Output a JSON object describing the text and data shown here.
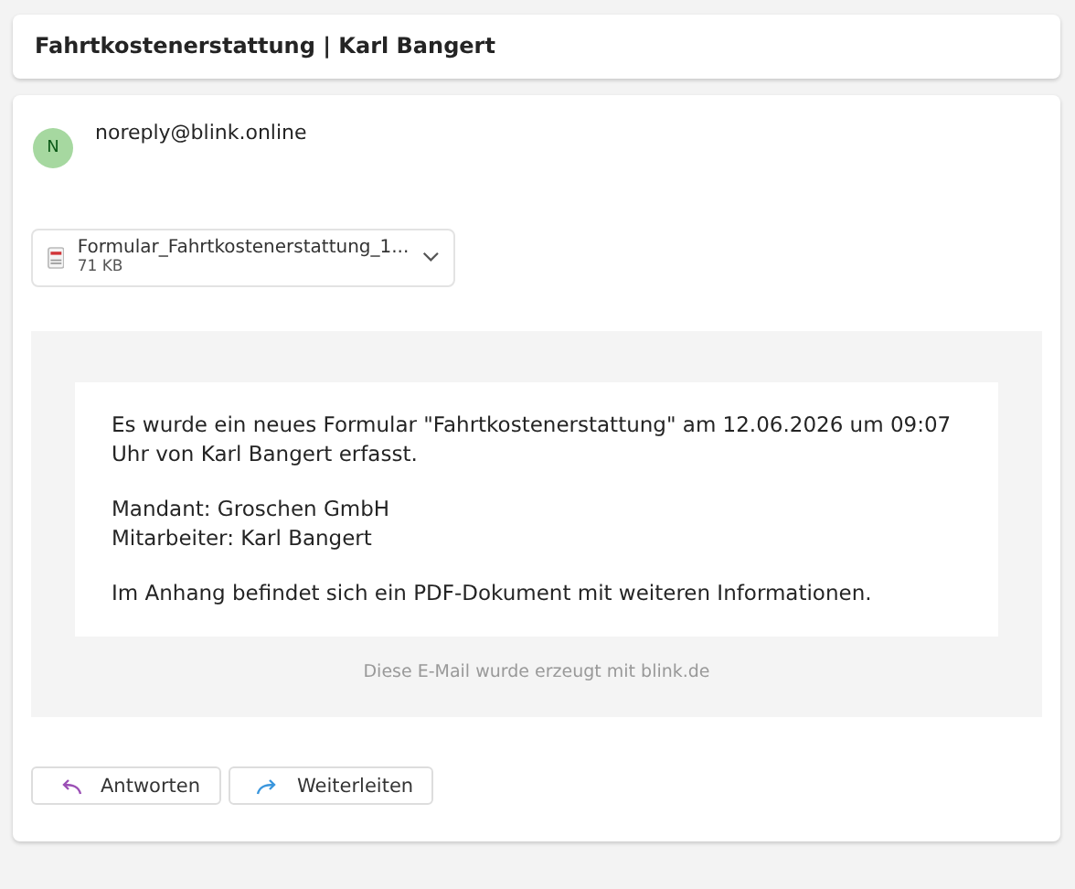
{
  "subject": "Fahrtkostenerstattung | Karl Bangert",
  "sender": {
    "initial": "N",
    "address": "noreply@blink.online"
  },
  "attachment": {
    "name": "Formular_Fahrtkostenerstattung_1...",
    "size": "71 KB"
  },
  "body": {
    "paragraphs": [
      [
        "Es wurde ein neues Formular \"Fahrtkostenerstattung\" am 12.06.2026 um 09:07 Uhr von Karl Bangert erfasst."
      ],
      [
        "Mandant: Groschen GmbH",
        "Mitarbeiter: Karl Bangert"
      ],
      [
        "Im Anhang befindet sich ein PDF-Dokument mit weiteren Informationen."
      ]
    ],
    "footer": "Diese E-Mail wurde erzeugt mit blink.de"
  },
  "actions": [
    {
      "kind": "reply",
      "label": "Antworten"
    },
    {
      "kind": "forward",
      "label": "Weiterleiten"
    }
  ]
}
